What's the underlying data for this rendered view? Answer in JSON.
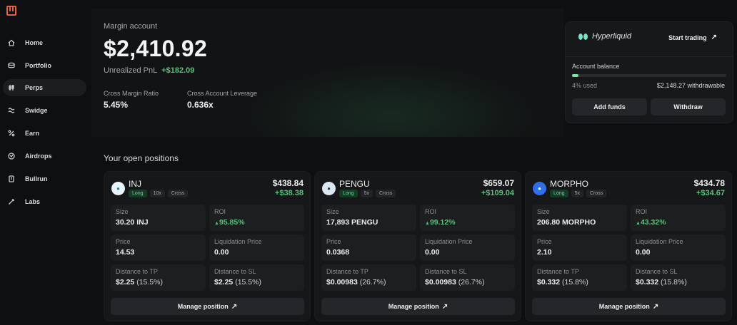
{
  "sidebar": {
    "items": [
      {
        "label": "Home",
        "icon": "home-icon",
        "active": false
      },
      {
        "label": "Portfolio",
        "icon": "portfolio-icon",
        "active": false
      },
      {
        "label": "Perps",
        "icon": "perps-icon",
        "active": true
      },
      {
        "label": "Swidge",
        "icon": "swidge-icon",
        "active": false
      },
      {
        "label": "Earn",
        "icon": "percent-icon",
        "active": false
      },
      {
        "label": "Airdrops",
        "icon": "airdrops-icon",
        "active": false
      },
      {
        "label": "Bullrun",
        "icon": "bullrun-icon",
        "active": false
      },
      {
        "label": "Labs",
        "icon": "labs-icon",
        "active": false
      }
    ]
  },
  "account": {
    "title": "Margin account",
    "balance": "$2,410.92",
    "pnl_label": "Unrealized PnL",
    "pnl_value": "+$182.09",
    "cross_margin_label": "Cross Margin Ratio",
    "cross_margin_value": "5.45%",
    "cross_leverage_label": "Cross Account Leverage",
    "cross_leverage_value": "0.636x"
  },
  "panel": {
    "brand": "Hyperliquid",
    "start_trading": "Start trading",
    "balance_label": "Account balance",
    "used_fraction": 0.04,
    "used_text": "4% used",
    "withdrawable": "$2,148.27 withdrawable",
    "add_funds": "Add funds",
    "withdraw": "Withdraw"
  },
  "positions": {
    "title": "Your open positions",
    "manage_label": "Manage position",
    "labels": {
      "size": "Size",
      "roi": "ROI",
      "price": "Price",
      "liq": "Liquidation Price",
      "tp": "Distance to TP",
      "sl": "Distance to SL"
    },
    "cards": [
      {
        "name": "INJ",
        "side": "Long",
        "leverage": "10x",
        "margin": "Cross",
        "value": "$438.84",
        "pnl": "+$38.38",
        "size": "30.20 INJ",
        "roi": "95.85%",
        "price": "14.53",
        "liq": "0.00",
        "tp": "$2.25",
        "tp_pct": "(15.5%)",
        "sl": "$2.25",
        "sl_pct": "(15.5%)",
        "icon_color": "#e9f4fb",
        "icon_fg": "#1b87c7"
      },
      {
        "name": "PENGU",
        "side": "Long",
        "leverage": "5x",
        "margin": "Cross",
        "value": "$659.07",
        "pnl": "+$109.04",
        "size": "17,893 PENGU",
        "roi": "99.12%",
        "price": "0.0368",
        "liq": "0.00",
        "tp": "$0.00983",
        "tp_pct": "(26.7%)",
        "sl": "$0.00983",
        "sl_pct": "(26.7%)",
        "icon_color": "#dce8f1",
        "icon_fg": "#2e3b4a"
      },
      {
        "name": "MORPHO",
        "side": "Long",
        "leverage": "5x",
        "margin": "Cross",
        "value": "$434.78",
        "pnl": "+$34.67",
        "size": "206.80 MORPHO",
        "roi": "43.32%",
        "price": "2.10",
        "liq": "0.00",
        "tp": "$0.332",
        "tp_pct": "(15.8%)",
        "sl": "$0.332",
        "sl_pct": "(15.8%)",
        "icon_color": "#2f6fe8",
        "icon_fg": "#ffffff"
      }
    ]
  }
}
